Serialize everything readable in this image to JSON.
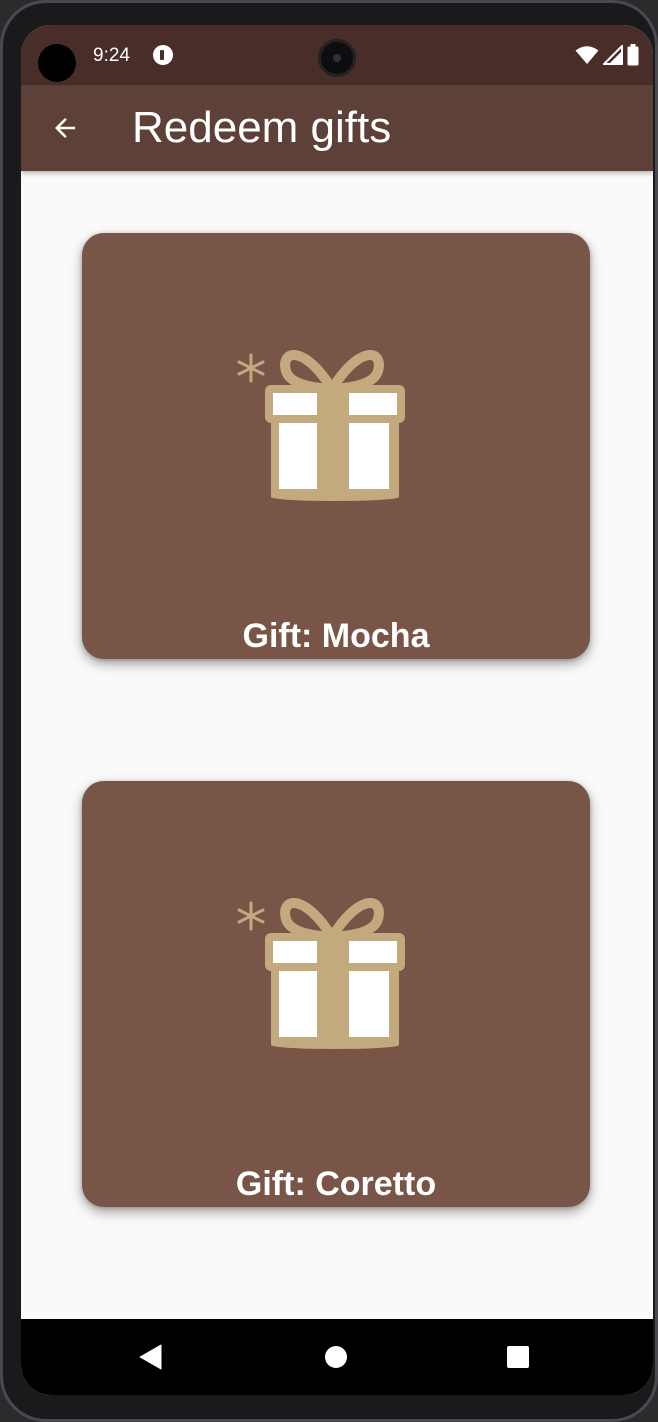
{
  "status_bar": {
    "time": "9:24",
    "icons": [
      "app-notification-icon",
      "wifi-icon",
      "signal-icon",
      "battery-icon"
    ]
  },
  "app_bar": {
    "back_icon": "arrow-back-icon",
    "title": "Redeem gifts"
  },
  "gifts": [
    {
      "label": "Gift: Mocha",
      "icon": "gift-box-icon"
    },
    {
      "label": "Gift: Coretto",
      "icon": "gift-box-icon"
    }
  ],
  "nav_bar": {
    "buttons": [
      "nav-back-icon",
      "nav-home-icon",
      "nav-recents-icon"
    ]
  },
  "colors": {
    "status_bar": "#482d28",
    "app_bar": "#5d4037",
    "card": "#795548",
    "gift_gold": "#c2a97e",
    "background": "#fafafa"
  }
}
